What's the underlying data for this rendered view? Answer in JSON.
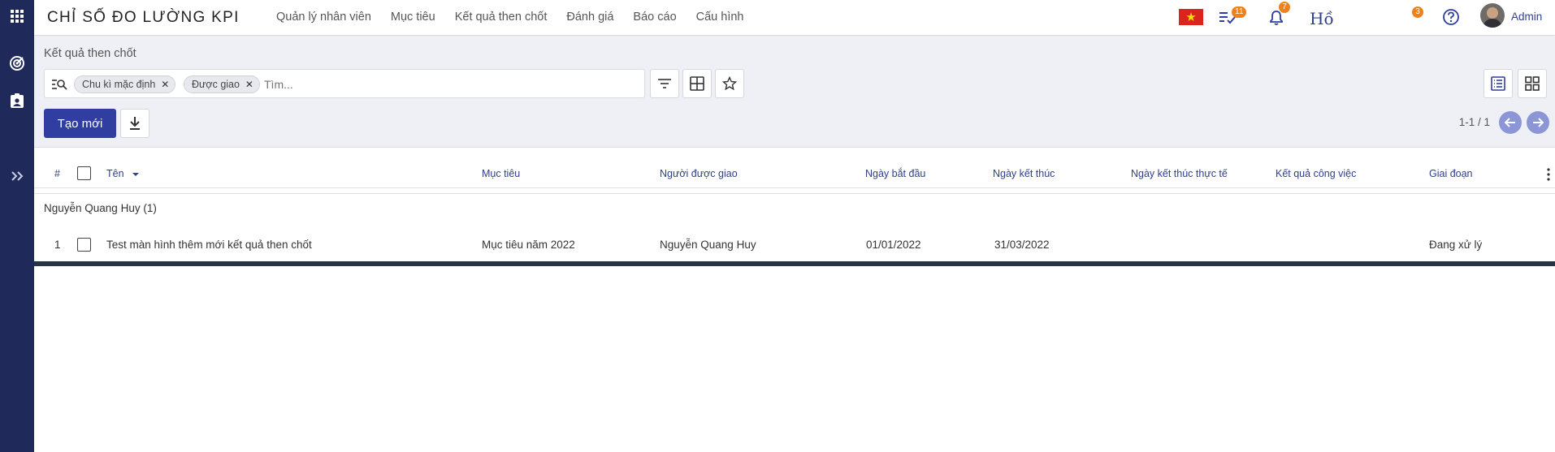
{
  "app": {
    "brand": "CHỈ SỐ ĐO LƯỜNG KPI",
    "menu": [
      "Quản lý nhân viên",
      "Mục tiêu",
      "Kết quả then chốt",
      "Đánh giá",
      "Báo cáo",
      "Cấu hình"
    ],
    "activity_count": "11",
    "notification_count": "7",
    "ho_label": "Hồ",
    "ho_count": "3",
    "user_name": "Admin"
  },
  "breadcrumb": "Kết quả then chốt",
  "search": {
    "facets": [
      "Chu kì mặc định",
      "Được giao"
    ],
    "placeholder": "Tìm..."
  },
  "actions": {
    "create_label": "Tạo mới"
  },
  "pager": {
    "text": "1-1 / 1"
  },
  "table": {
    "headers": {
      "index": "#",
      "name": "Tên",
      "objective": "Mục tiêu",
      "assignee": "Người được giao",
      "start_date": "Ngày bắt đầu",
      "end_date": "Ngày kết thúc",
      "actual_end_date": "Ngày kết thúc thực tế",
      "work_result": "Kết quả công việc",
      "stage": "Giai đoạn"
    },
    "group_label": "Nguyễn Quang Huy (1)",
    "rows": [
      {
        "index": "1",
        "name": "Test màn hình thêm mới kết quả then chốt",
        "objective": "Mục tiêu năm 2022",
        "assignee": "Nguyễn Quang Huy",
        "start_date": "01/01/2022",
        "end_date": "31/03/2022",
        "actual_end_date": "",
        "work_result": "",
        "stage": "Đang xử lý"
      }
    ]
  },
  "colors": {
    "rail": "#1f2a5a",
    "primary": "#2f3ea0",
    "header_text": "#2f3e8f",
    "badge": "#f0801a"
  }
}
